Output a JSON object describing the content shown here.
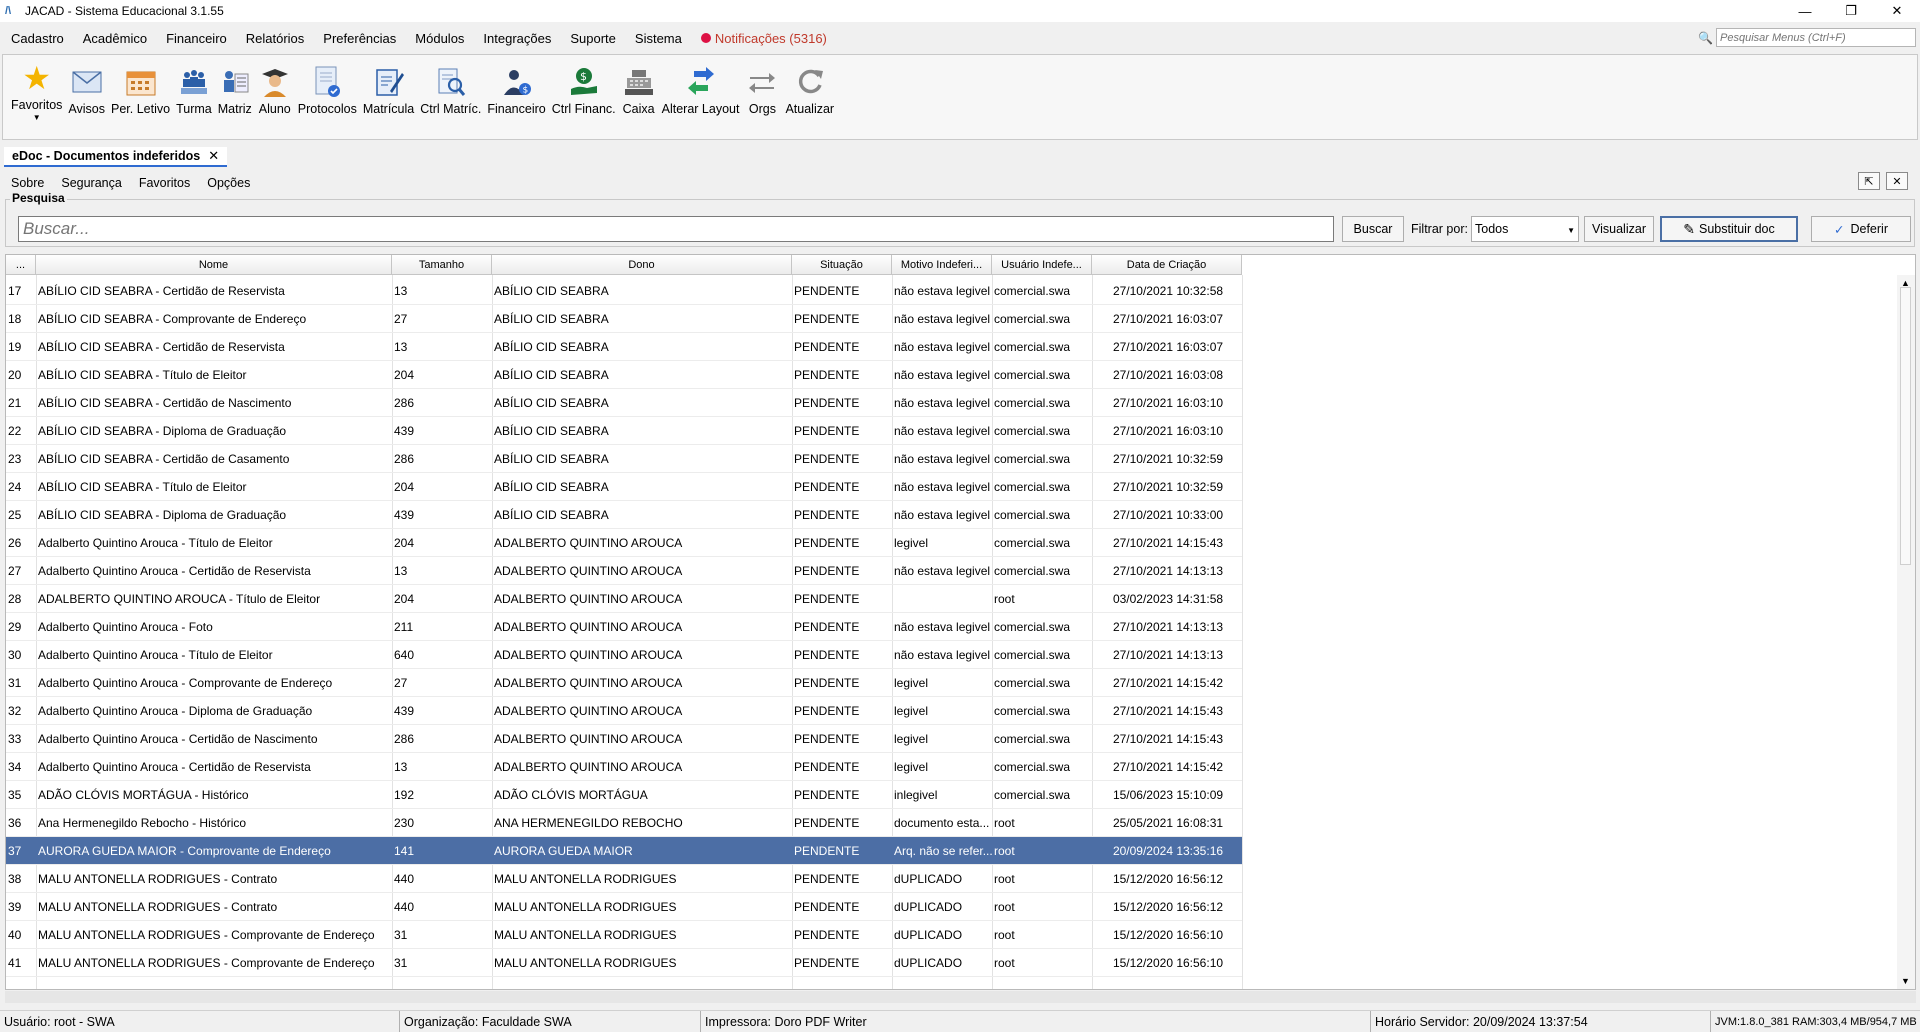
{
  "window": {
    "title": "JACAD - Sistema Educacional 3.1.55"
  },
  "menu": {
    "items": [
      "Cadastro",
      "Acadêmico",
      "Financeiro",
      "Relatórios",
      "Preferências",
      "Módulos",
      "Integrações",
      "Suporte",
      "Sistema"
    ],
    "notifications": "Notificações (5316)",
    "search_placeholder": "Pesquisar Menus (Ctrl+F)"
  },
  "toolbar": [
    {
      "label": "Favoritos",
      "icon": "star-icon"
    },
    {
      "label": "Avisos",
      "icon": "envelope-icon"
    },
    {
      "label": "Per. Letivo",
      "icon": "calendar-icon"
    },
    {
      "label": "Turma",
      "icon": "class-group-icon"
    },
    {
      "label": "Matriz",
      "icon": "matrix-icon"
    },
    {
      "label": "Aluno",
      "icon": "student-icon"
    },
    {
      "label": "Protocolos",
      "icon": "protocol-document-icon"
    },
    {
      "label": "Matrícula",
      "icon": "enrollment-form-icon"
    },
    {
      "label": "Ctrl Matríc.",
      "icon": "enrollment-control-icon"
    },
    {
      "label": "Financeiro",
      "icon": "finance-person-icon"
    },
    {
      "label": "Ctrl Financ.",
      "icon": "money-hand-icon"
    },
    {
      "label": "Caixa",
      "icon": "cash-register-icon"
    },
    {
      "label": "Alterar Layout",
      "icon": "swap-arrows-icon"
    },
    {
      "label": "Orgs",
      "icon": "orgs-arrows-icon"
    },
    {
      "label": "Atualizar",
      "icon": "refresh-icon"
    }
  ],
  "tab": {
    "title": "eDoc - Documentos indeferidos"
  },
  "submenu": [
    "Sobre",
    "Segurança",
    "Favoritos",
    "Opções"
  ],
  "search": {
    "legend": "Pesquisa",
    "placeholder": "Buscar...",
    "buscar": "Buscar",
    "filter_label": "Filtrar por:",
    "filter_value": "Todos",
    "visualizar": "Visualizar",
    "substituir": "Substituir doc",
    "deferir": "Deferir"
  },
  "table": {
    "columns": [
      "...",
      "Nome",
      "Tamanho",
      "Dono",
      "Situação",
      "Motivo Indeferi...",
      "Usuário Indefe...",
      "Data de Criação"
    ],
    "selected_index": 20,
    "rows": [
      [
        "17",
        "ABÍLIO CID SEABRA - Certidão de Reservista",
        "13",
        "ABÍLIO CID SEABRA",
        "PENDENTE",
        "não estava legivel",
        "comercial.swa",
        "27/10/2021 10:32:58"
      ],
      [
        "18",
        "ABÍLIO CID SEABRA - Comprovante de Endereço",
        "27",
        "ABÍLIO CID SEABRA",
        "PENDENTE",
        "não estava legivel",
        "comercial.swa",
        "27/10/2021 16:03:07"
      ],
      [
        "19",
        "ABÍLIO CID SEABRA - Certidão de Reservista",
        "13",
        "ABÍLIO CID SEABRA",
        "PENDENTE",
        "não estava legivel",
        "comercial.swa",
        "27/10/2021 16:03:07"
      ],
      [
        "20",
        "ABÍLIO CID SEABRA - Título de Eleitor",
        "204",
        "ABÍLIO CID SEABRA",
        "PENDENTE",
        "não estava legivel",
        "comercial.swa",
        "27/10/2021 16:03:08"
      ],
      [
        "21",
        "ABÍLIO CID SEABRA - Certidão de Nascimento",
        "286",
        "ABÍLIO CID SEABRA",
        "PENDENTE",
        "não estava legivel",
        "comercial.swa",
        "27/10/2021 16:03:10"
      ],
      [
        "22",
        "ABÍLIO CID SEABRA - Diploma de Graduação",
        "439",
        "ABÍLIO CID SEABRA",
        "PENDENTE",
        "não estava legivel",
        "comercial.swa",
        "27/10/2021 16:03:10"
      ],
      [
        "23",
        "ABÍLIO CID SEABRA - Certidão de Casamento",
        "286",
        "ABÍLIO CID SEABRA",
        "PENDENTE",
        "não estava legivel",
        "comercial.swa",
        "27/10/2021 10:32:59"
      ],
      [
        "24",
        "ABÍLIO CID SEABRA - Título de Eleitor",
        "204",
        "ABÍLIO CID SEABRA",
        "PENDENTE",
        "não estava legivel",
        "comercial.swa",
        "27/10/2021 10:32:59"
      ],
      [
        "25",
        "ABÍLIO CID SEABRA - Diploma de Graduação",
        "439",
        "ABÍLIO CID SEABRA",
        "PENDENTE",
        "não estava legivel",
        "comercial.swa",
        "27/10/2021 10:33:00"
      ],
      [
        "26",
        "Adalberto Quintino Arouca - Título de Eleitor",
        "204",
        "ADALBERTO QUINTINO AROUCA",
        "PENDENTE",
        "legivel",
        "comercial.swa",
        "27/10/2021 14:15:43"
      ],
      [
        "27",
        "Adalberto Quintino Arouca - Certidão de Reservista",
        "13",
        "ADALBERTO QUINTINO AROUCA",
        "PENDENTE",
        "não estava legivel",
        "comercial.swa",
        "27/10/2021 14:13:13"
      ],
      [
        "28",
        "ADALBERTO QUINTINO AROUCA - Título de Eleitor",
        "204",
        "ADALBERTO QUINTINO AROUCA",
        "PENDENTE",
        "",
        "root",
        "03/02/2023 14:31:58"
      ],
      [
        "29",
        "Adalberto Quintino Arouca - Foto",
        "211",
        "ADALBERTO QUINTINO AROUCA",
        "PENDENTE",
        "não estava legivel",
        "comercial.swa",
        "27/10/2021 14:13:13"
      ],
      [
        "30",
        "Adalberto Quintino Arouca - Título de Eleitor",
        "640",
        "ADALBERTO QUINTINO AROUCA",
        "PENDENTE",
        "não estava legivel",
        "comercial.swa",
        "27/10/2021 14:13:13"
      ],
      [
        "31",
        "Adalberto Quintino Arouca - Comprovante de Endereço",
        "27",
        "ADALBERTO QUINTINO AROUCA",
        "PENDENTE",
        "legivel",
        "comercial.swa",
        "27/10/2021 14:15:42"
      ],
      [
        "32",
        "Adalberto Quintino Arouca - Diploma de Graduação",
        "439",
        "ADALBERTO QUINTINO AROUCA",
        "PENDENTE",
        "legivel",
        "comercial.swa",
        "27/10/2021 14:15:43"
      ],
      [
        "33",
        "Adalberto Quintino Arouca - Certidão de Nascimento",
        "286",
        "ADALBERTO QUINTINO AROUCA",
        "PENDENTE",
        "legivel",
        "comercial.swa",
        "27/10/2021 14:15:43"
      ],
      [
        "34",
        "Adalberto Quintino Arouca - Certidão de Reservista",
        "13",
        "ADALBERTO QUINTINO AROUCA",
        "PENDENTE",
        "legivel",
        "comercial.swa",
        "27/10/2021 14:15:42"
      ],
      [
        "35",
        "ADÃO CLÓVIS MORTÁGUA - Histórico",
        "192",
        "ADÃO CLÓVIS MORTÁGUA",
        "PENDENTE",
        "inlegivel",
        "comercial.swa",
        "15/06/2023 15:10:09"
      ],
      [
        "36",
        "Ana Hermenegildo Rebocho - Histórico",
        "230",
        "ANA HERMENEGILDO REBOCHO",
        "PENDENTE",
        "documento esta...",
        "root",
        "25/05/2021 16:08:31"
      ],
      [
        "37",
        "AURORA GUEDA MAIOR - Comprovante de Endereço",
        "141",
        "AURORA GUEDA MAIOR",
        "PENDENTE",
        "Arq. não se refer...",
        "root",
        "20/09/2024 13:35:16"
      ],
      [
        "38",
        "MALU ANTONELLA RODRIGUES - Contrato",
        "440",
        "MALU ANTONELLA RODRIGUES",
        "PENDENTE",
        "dUPLICADO",
        "root",
        "15/12/2020 16:56:12"
      ],
      [
        "39",
        "MALU ANTONELLA RODRIGUES - Contrato",
        "440",
        "MALU ANTONELLA RODRIGUES",
        "PENDENTE",
        "dUPLICADO",
        "root",
        "15/12/2020 16:56:12"
      ],
      [
        "40",
        "MALU ANTONELLA RODRIGUES - Comprovante de Endereço",
        "31",
        "MALU ANTONELLA RODRIGUES",
        "PENDENTE",
        "dUPLICADO",
        "root",
        "15/12/2020 16:56:10"
      ],
      [
        "41",
        "MALU ANTONELLA RODRIGUES - Comprovante de Endereço",
        "31",
        "MALU ANTONELLA RODRIGUES",
        "PENDENTE",
        "dUPLICADO",
        "root",
        "15/12/2020 16:56:10"
      ]
    ]
  },
  "status": {
    "user": "Usuário: root - SWA",
    "org": "Organização: Faculdade SWA",
    "printer": "Impressora: Doro PDF Writer",
    "server_time": "Horário Servidor: 20/09/2024 13:37:54",
    "jvm": "JVM:1.8.0_381  RAM:303,4 MB/954,7 MB"
  },
  "colors": {
    "selection": "#4c6ea5",
    "notification": "#c0392b",
    "tab_accent": "#2f6bd1"
  }
}
